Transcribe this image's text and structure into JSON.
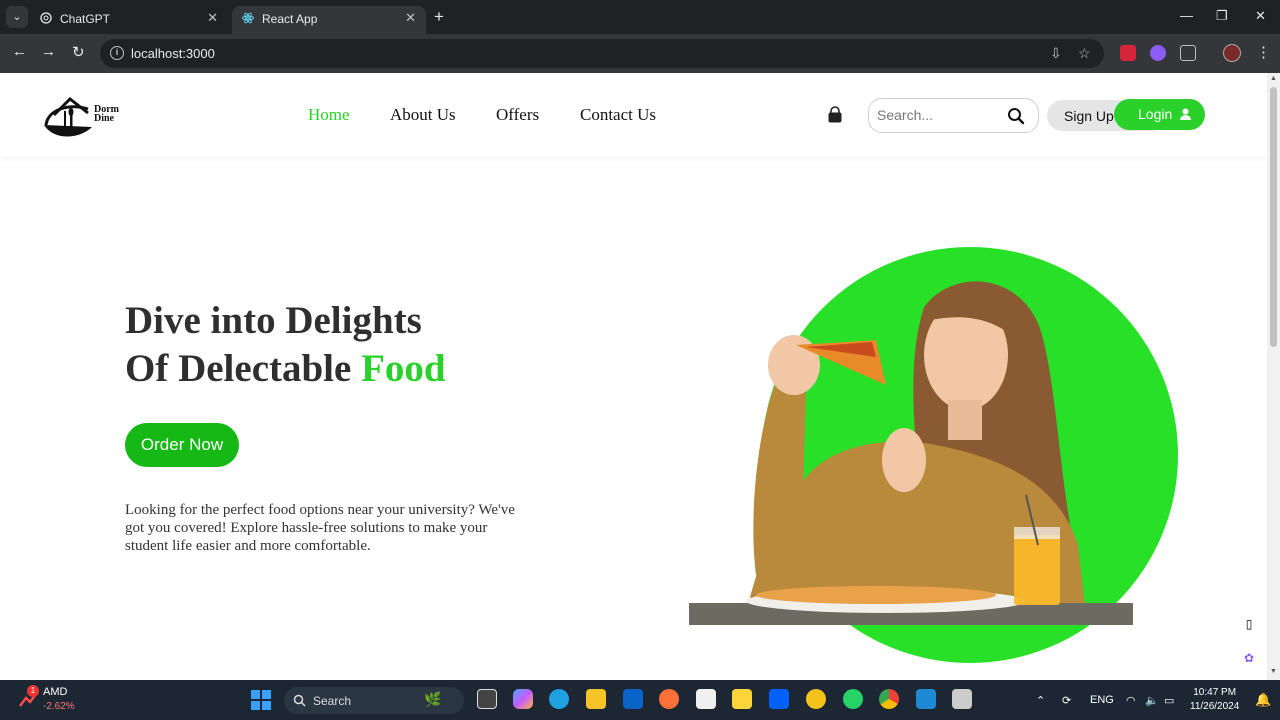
{
  "browser": {
    "tabs": [
      {
        "title": "ChatGPT",
        "active": false
      },
      {
        "title": "React App",
        "active": true
      }
    ],
    "url": "localhost:3000"
  },
  "site": {
    "logo_text_top": "Dorm",
    "logo_text_bottom": "Dine",
    "nav": [
      {
        "label": "Home",
        "active": true
      },
      {
        "label": "About Us",
        "active": false
      },
      {
        "label": "Offers",
        "active": false
      },
      {
        "label": "Contact Us",
        "active": false
      }
    ],
    "search_placeholder": "Search...",
    "signup_label": "Sign Up",
    "login_label": "Login",
    "hero": {
      "title_line1": "Dive into Delights",
      "title_line2_prefix": "Of Delectable ",
      "title_line2_accent": "Food",
      "cta_label": "Order Now",
      "description": "Looking for the perfect food options near your university? We've got you covered! Explore hassle-free solutions to make your student life easier and more comfortable."
    },
    "accent_color": "#2ad12a"
  },
  "taskbar": {
    "stock_name": "AMD",
    "stock_change": "-2.62%",
    "stock_badge": "1",
    "search_label": "Search",
    "language": "ENG",
    "time": "10:47 PM",
    "date": "11/26/2024"
  }
}
